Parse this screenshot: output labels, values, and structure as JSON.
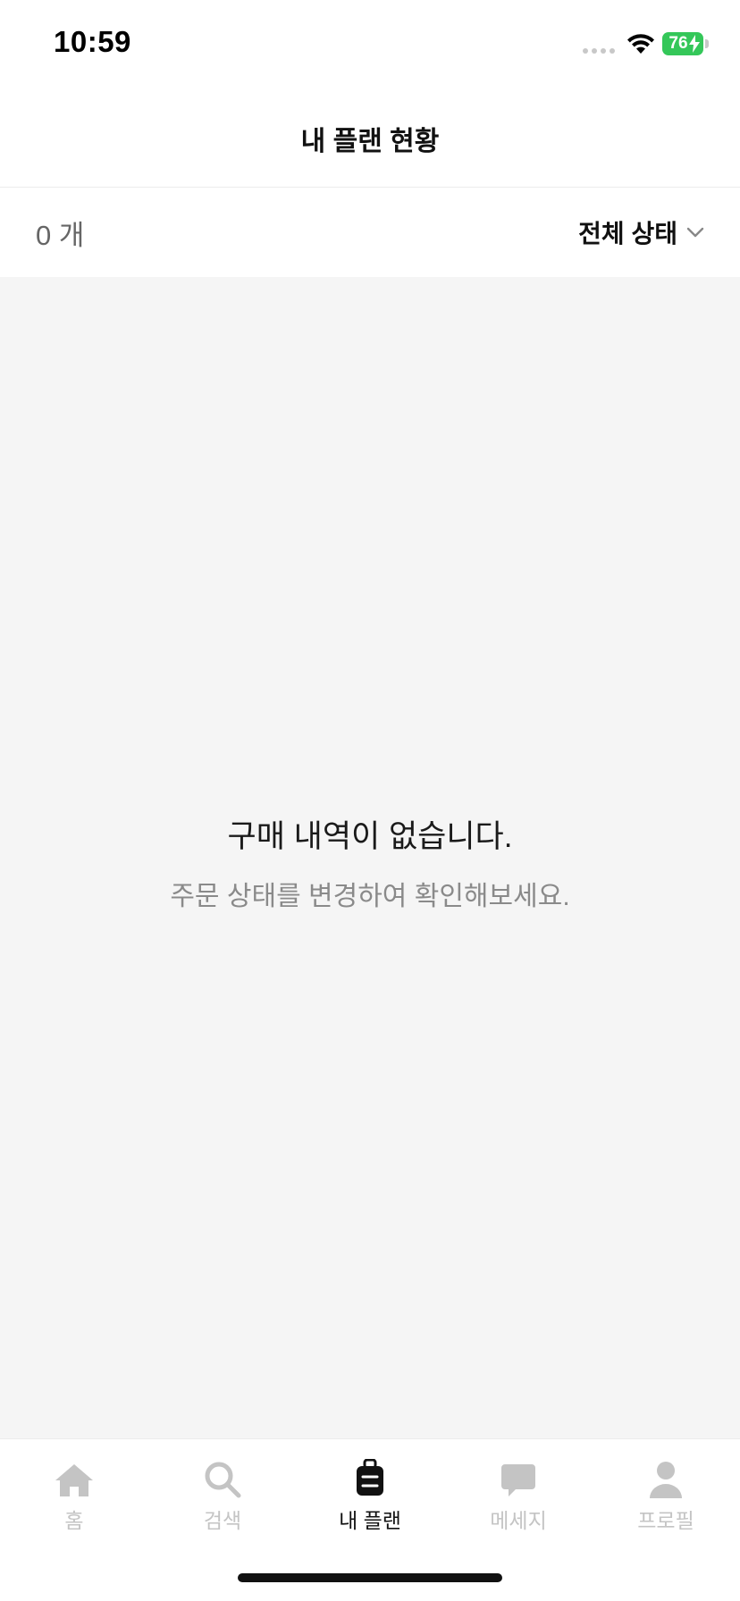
{
  "status_bar": {
    "time": "10:59",
    "battery": "76"
  },
  "header": {
    "title": "내 플랜 현황"
  },
  "filter": {
    "count": "0 개",
    "status_label": "전체 상태"
  },
  "empty_state": {
    "title": "구매 내역이 없습니다.",
    "subtitle": "주문 상태를 변경하여 확인해보세요."
  },
  "tabs": [
    {
      "label": "홈",
      "icon": "home-icon",
      "active": false
    },
    {
      "label": "검색",
      "icon": "search-icon",
      "active": false
    },
    {
      "label": "내 플랜",
      "icon": "luggage-icon",
      "active": true
    },
    {
      "label": "메세지",
      "icon": "chat-bubble-icon",
      "active": false
    },
    {
      "label": "프로필",
      "icon": "person-icon",
      "active": false
    }
  ],
  "colors": {
    "accent": "#111111",
    "inactive_tab": "#c4c4c4",
    "background": "#f5f5f5",
    "battery": "#34c759"
  }
}
